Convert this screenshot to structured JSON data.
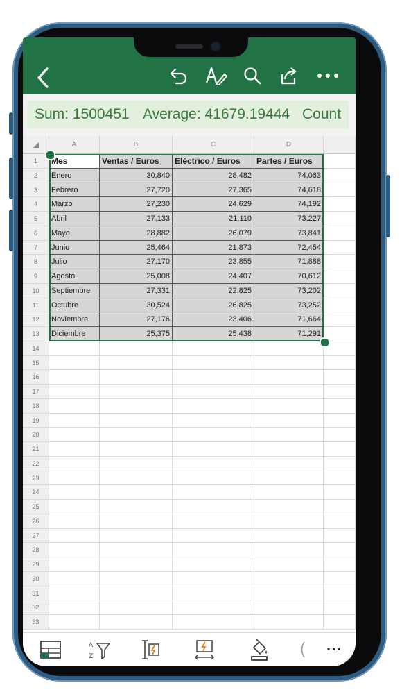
{
  "toolbar": {
    "back_icon": "chevron-left-icon",
    "undo_icon": "undo-icon",
    "edit_icon": "pen-icon",
    "search_icon": "search-icon",
    "share_icon": "share-icon",
    "more_icon": "ellipsis-icon",
    "color": "#217346"
  },
  "status": {
    "sum": "Sum: 1500451",
    "average": "Average: 41679.19444",
    "count": "Count"
  },
  "sheet": {
    "columns": [
      "A",
      "B",
      "C",
      "D"
    ],
    "headers": [
      "Mes",
      "Ventas / Euros",
      "Eléctrico / Euros",
      "Partes / Euros"
    ],
    "rows": [
      [
        "Enero",
        "30,840",
        "28,482",
        "74,063"
      ],
      [
        "Febrero",
        "27,720",
        "27,365",
        "74,618"
      ],
      [
        "Marzo",
        "27,230",
        "24,629",
        "74,192"
      ],
      [
        "Abril",
        "27,133",
        "21,110",
        "73,227"
      ],
      [
        "Mayo",
        "28,882",
        "26,079",
        "73,841"
      ],
      [
        "Junio",
        "25,464",
        "21,873",
        "72,454"
      ],
      [
        "Julio",
        "27,170",
        "23,855",
        "71,888"
      ],
      [
        "Agosto",
        "25,008",
        "24,407",
        "70,612"
      ],
      [
        "Septiembre",
        "27,331",
        "22,825",
        "73,202"
      ],
      [
        "Octubre",
        "30,524",
        "26,825",
        "73,252"
      ],
      [
        "Noviembre",
        "27,176",
        "23,406",
        "71,664"
      ],
      [
        "Diciembre",
        "25,375",
        "25,438",
        "71,291"
      ]
    ],
    "row_numbers": [
      "1",
      "2",
      "3",
      "4",
      "5",
      "6",
      "7",
      "8",
      "9",
      "10",
      "11",
      "12",
      "13",
      "14",
      "15",
      "16",
      "17",
      "18",
      "19",
      "20",
      "21",
      "22",
      "23",
      "24",
      "25",
      "26",
      "27",
      "28",
      "29",
      "30",
      "31",
      "32",
      "33"
    ]
  },
  "bottombar": {
    "icons": [
      "table-icon",
      "sort-filter-icon",
      "insert-row-icon",
      "insert-column-icon",
      "fill-color-icon",
      "partial-icon",
      "ellipsis-icon"
    ],
    "more_label": "···"
  }
}
